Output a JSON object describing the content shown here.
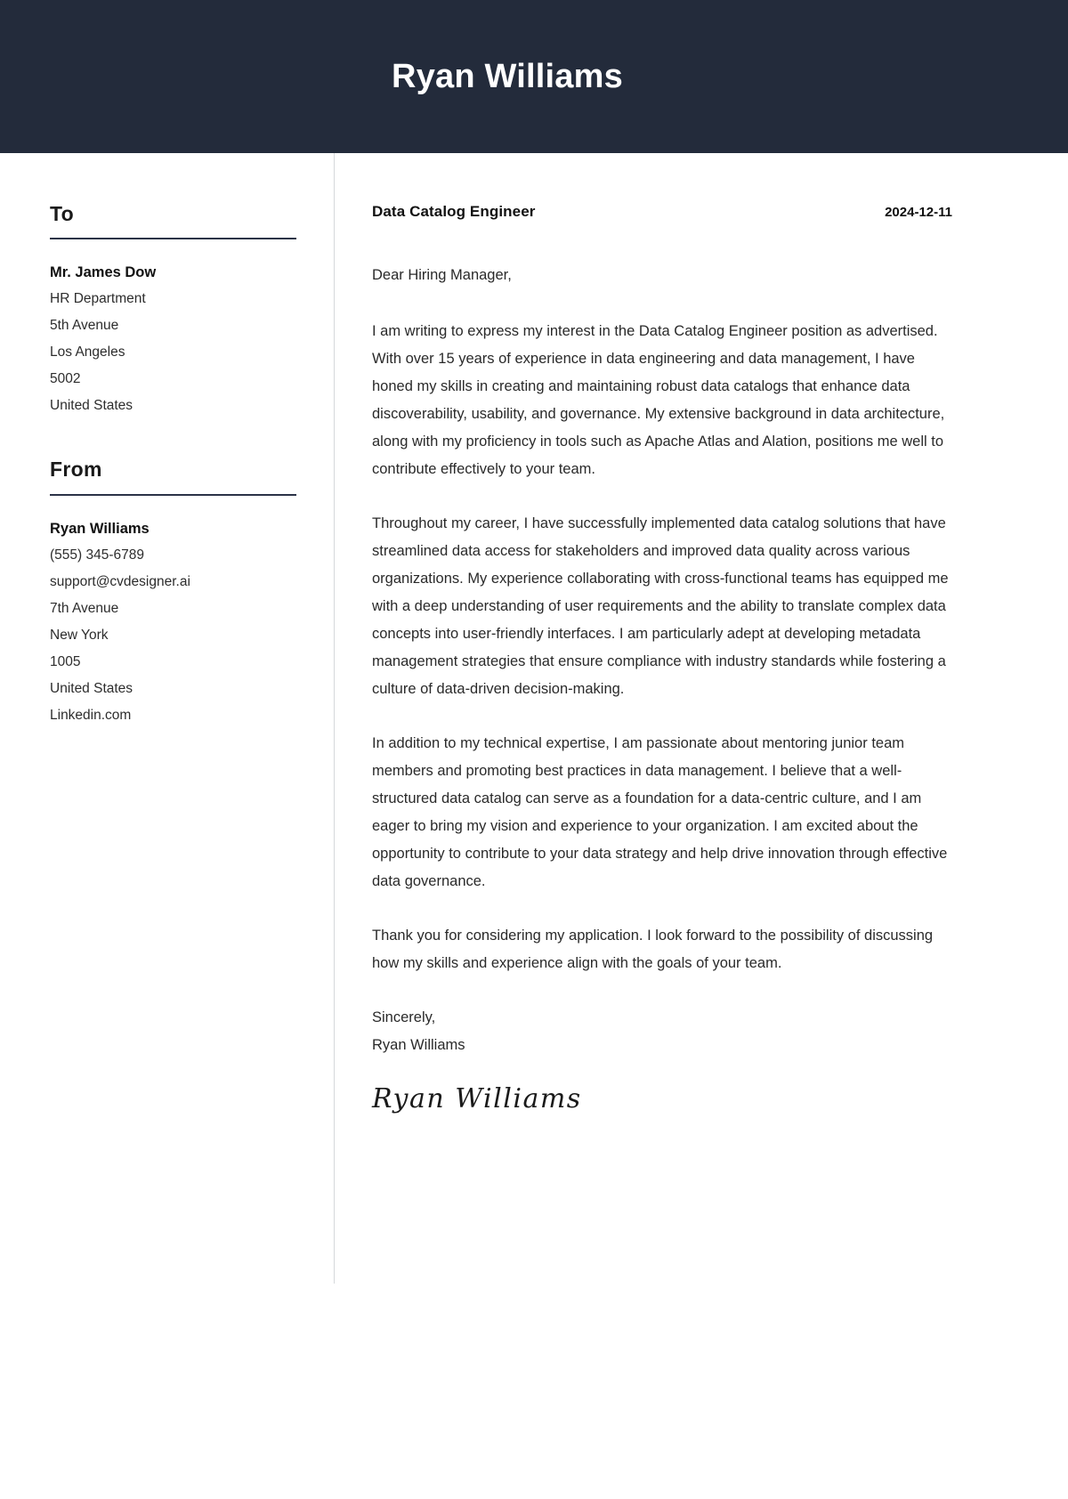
{
  "header": {
    "full_name": "Ryan Williams"
  },
  "sidebar": {
    "to": {
      "heading": "To",
      "lines": [
        "Mr. James Dow",
        "HR Department",
        "5th Avenue",
        "Los Angeles",
        "5002",
        "United States"
      ]
    },
    "from": {
      "heading": "From",
      "lines": [
        "Ryan Williams",
        "(555) 345-6789",
        "support@cvdesigner.ai",
        "7th Avenue",
        "New York",
        "1005",
        "United States",
        "Linkedin.com"
      ]
    }
  },
  "letter": {
    "job_title": "Data Catalog Engineer",
    "date": "2024-12-11",
    "salutation": "Dear Hiring Manager,",
    "paragraphs": [
      "I am writing to express my interest in the Data Catalog Engineer position as advertised. With over 15 years of experience in data engineering and data management, I have honed my skills in creating and maintaining robust data catalogs that enhance data discoverability, usability, and governance. My extensive background in data architecture, along with my proficiency in tools such as Apache Atlas and Alation, positions me well to contribute effectively to your team.",
      "Throughout my career, I have successfully implemented data catalog solutions that have streamlined data access for stakeholders and improved data quality across various organizations. My experience collaborating with cross-functional teams has equipped me with a deep understanding of user requirements and the ability to translate complex data concepts into user-friendly interfaces. I am particularly adept at developing metadata management strategies that ensure compliance with industry standards while fostering a culture of data-driven decision-making.",
      "In addition to my technical expertise, I am passionate about mentoring junior team members and promoting best practices in data management. I believe that a well-structured data catalog can serve as a foundation for a data-centric culture, and I am eager to bring my vision and experience to your organization. I am excited about the opportunity to contribute to your data strategy and help drive innovation through effective data governance.",
      "Thank you for considering my application. I look forward to the possibility of discussing how my skills and experience align with the goals of your team."
    ],
    "closing_word": "Sincerely,",
    "closing_name": "Ryan Williams",
    "signature": "Ryan Williams"
  },
  "colors": {
    "header_background": "#232b3b",
    "rule": "#2b3347",
    "divider": "#d6d8db",
    "text": "#2a2a2a"
  }
}
